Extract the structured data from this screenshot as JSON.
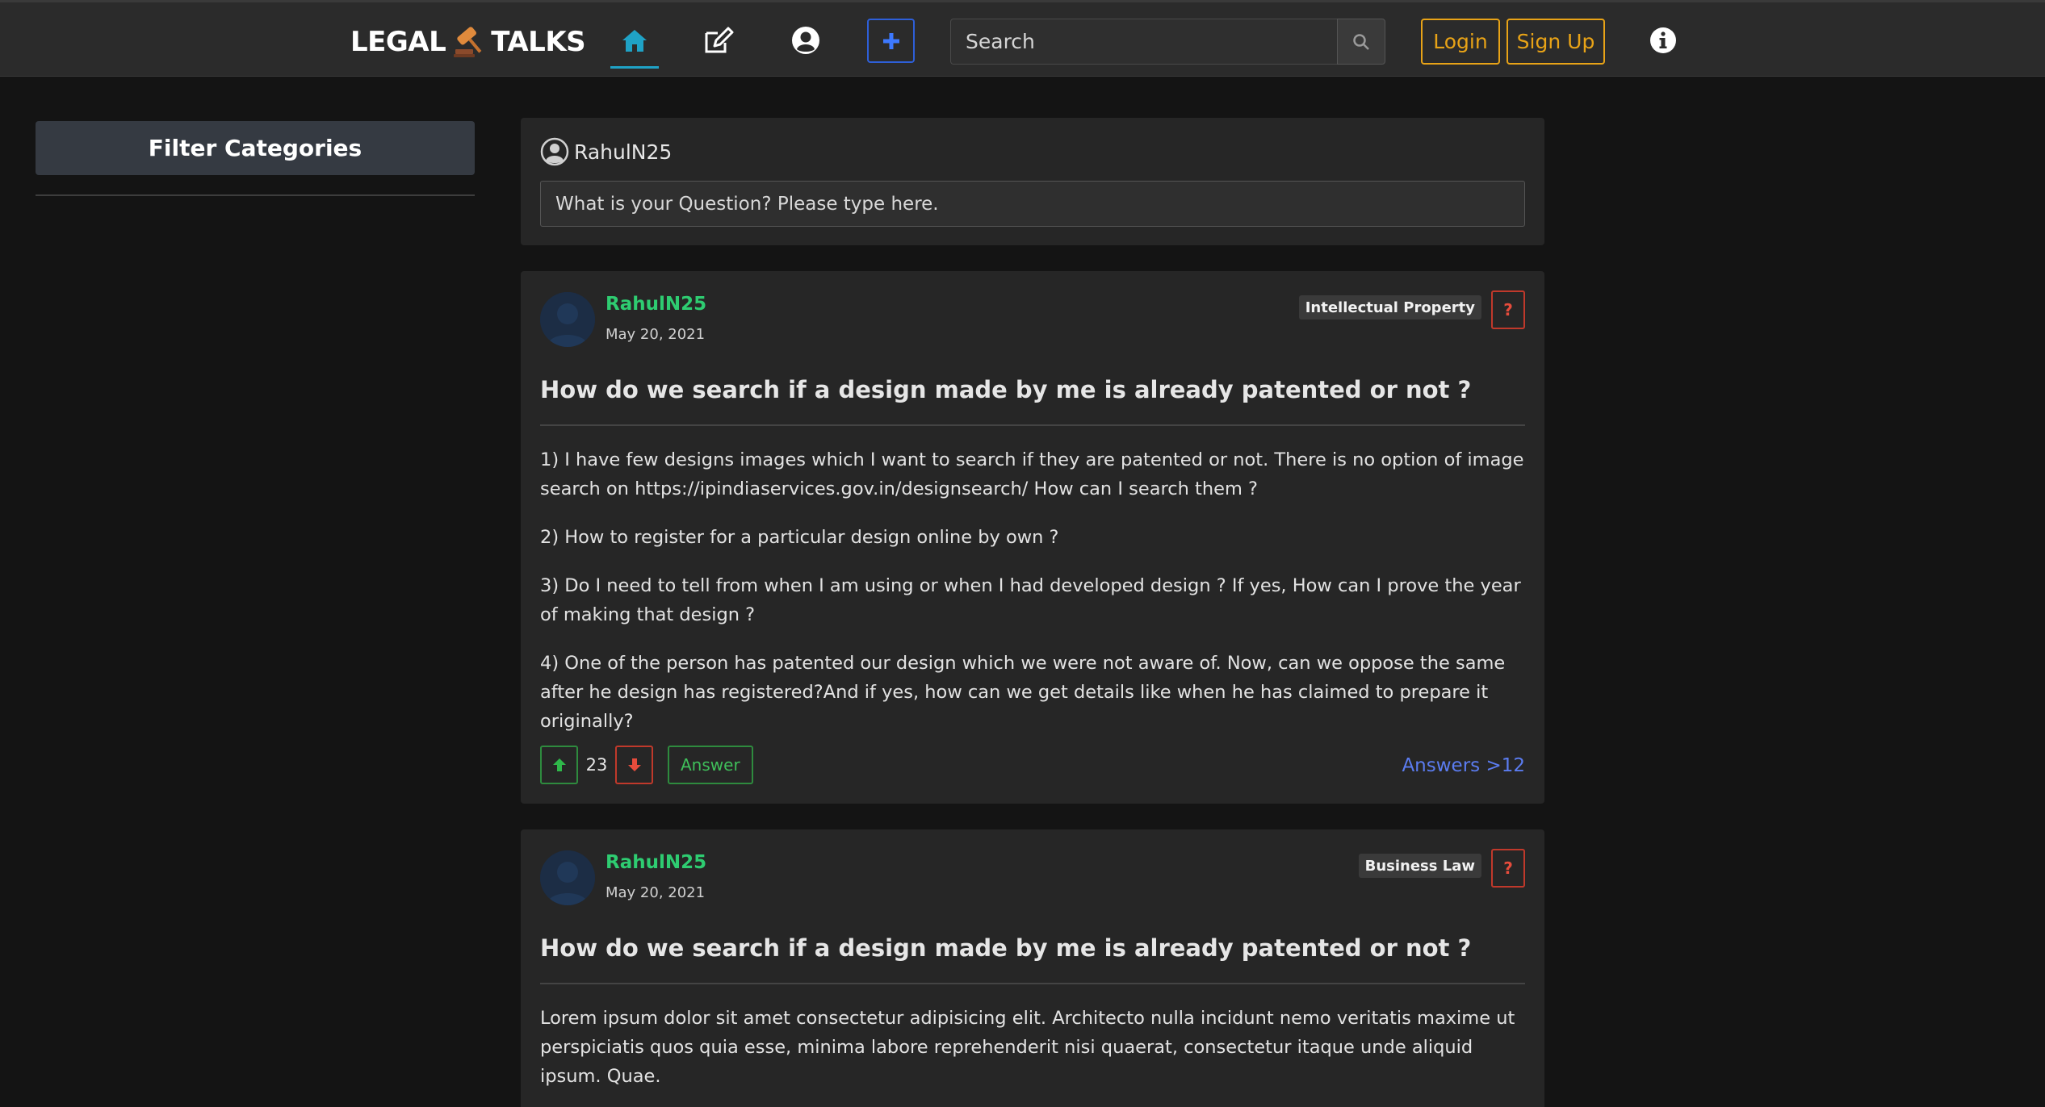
{
  "navbar": {
    "brand_left": "LEGAL",
    "brand_right": "TALKS",
    "search_placeholder": "Search",
    "login_label": "Login",
    "signup_label": "Sign Up"
  },
  "sidebar": {
    "filter_title": "Filter Categories"
  },
  "ask": {
    "username": "RahulN25",
    "placeholder": "What is your Question? Please type here."
  },
  "questions": [
    {
      "author": "RahulN25",
      "date": "May 20, 2021",
      "category": "Intellectual Property",
      "title": "How do we search if a design made by me is already patented or not ?",
      "paragraphs": [
        "1) I have few designs images which I want to search if they are patented or not. There is no option of image search on https://ipindiaservices.gov.in/designsearch/ How can I search them ?",
        "2) How to register for a particular design online by own ?",
        "3) Do I need to tell from when I am using or when I had developed design ? If yes, How can I prove the year of making that design ?",
        "4) One of the person has patented our design which we were not aware of. Now, can we oppose the same after he design has registered?And if yes, how can we get details like when he has claimed to prepare it originally?"
      ],
      "votes": "23",
      "answer_label": "Answer",
      "answers_link": "Answers >12"
    },
    {
      "author": "RahulN25",
      "date": "May 20, 2021",
      "category": "Business Law",
      "title": "How do we search if a design made by me is already patented or not ?",
      "paragraphs": [
        "Lorem ipsum dolor sit amet consectetur adipisicing elit. Architecto nulla incidunt nemo veritatis maxime ut perspiciatis quos quia esse, minima labore reprehenderit nisi quaerat, consectetur itaque unde aliquid ipsum. Quae."
      ]
    }
  ],
  "colors": {
    "accent_blue": "#2e5fd8",
    "home_underline": "#1fa2c6",
    "auth_yellow": "#e8a317",
    "author_green": "#2ecc71",
    "upvote_green": "#2e8b3e",
    "downvote_red": "#c0392b",
    "link_blue": "#5b7cf0"
  },
  "icons": [
    "gavel-icon",
    "home-icon",
    "edit-icon",
    "user-circle-icon",
    "plus-icon",
    "search-icon",
    "info-icon",
    "arrow-up-icon",
    "arrow-down-icon",
    "question-icon"
  ]
}
